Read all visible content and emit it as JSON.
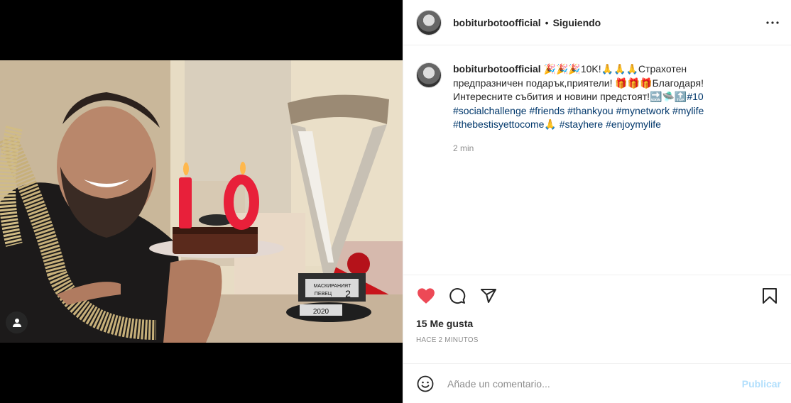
{
  "post": {
    "username": "bobiturbotoofficial",
    "separator": "•",
    "follow_status": "Siguiendo",
    "caption_text": " 🎉🎉🎉10K!🙏🙏🙏Страхотен предпразничен подарък,приятели! 🎁🎁🎁Благодаря! Интересните събития и новини предстоят!🔜🛸🔝",
    "caption_hashtags": "#10 #socialchallenge #friends #thankyou #mynetwork #mylife #thebestisyettocome🙏 #stayhere #enjoymylife",
    "caption_time": "2 min",
    "likes": "15 Me gusta",
    "posted_ago": "Hace 2 minutos"
  },
  "comment": {
    "placeholder": "Añade un comentario...",
    "publish_label": "Publicar"
  },
  "photo": {
    "candle_digits": "10",
    "trophy_plate_1": "МАСКИРАНИЯТ",
    "trophy_plate_2": "ПЕВЕЦ",
    "trophy_plate_num": "2",
    "trophy_year": "2020"
  },
  "icons": {
    "more": "more-options-icon",
    "like": "heart-icon",
    "comment": "comment-icon",
    "share": "share-icon",
    "save": "bookmark-icon",
    "emoji": "emoji-icon",
    "tag": "user-tag-icon"
  },
  "colors": {
    "like_red": "#ed4956",
    "hashtag": "#00376b",
    "publish_disabled": "#b2dffc",
    "muted": "#8e8e8e"
  }
}
